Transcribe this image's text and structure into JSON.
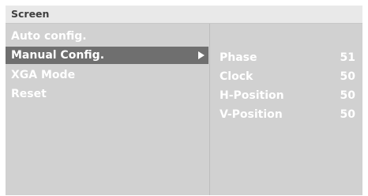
{
  "window": {
    "title": "Screen"
  },
  "menu": {
    "items": [
      {
        "label": "Auto config."
      },
      {
        "label": "Manual Config.",
        "selected": true
      },
      {
        "label": "XGA Mode"
      },
      {
        "label": "Reset"
      }
    ],
    "submenu_arrow_icon": "right-triangle-arrow"
  },
  "settings": [
    {
      "name": "Phase",
      "value": "51"
    },
    {
      "name": "Clock",
      "value": "50"
    },
    {
      "name": "H-Position",
      "value": "50"
    },
    {
      "name": "V-Position",
      "value": "50"
    }
  ],
  "colors": {
    "panel_background": "#d1d1d1",
    "title_background": "#e9e9e9",
    "title_text": "#3f3f3f",
    "selected_background": "#6f6f6f",
    "item_text": "#ffffff"
  }
}
